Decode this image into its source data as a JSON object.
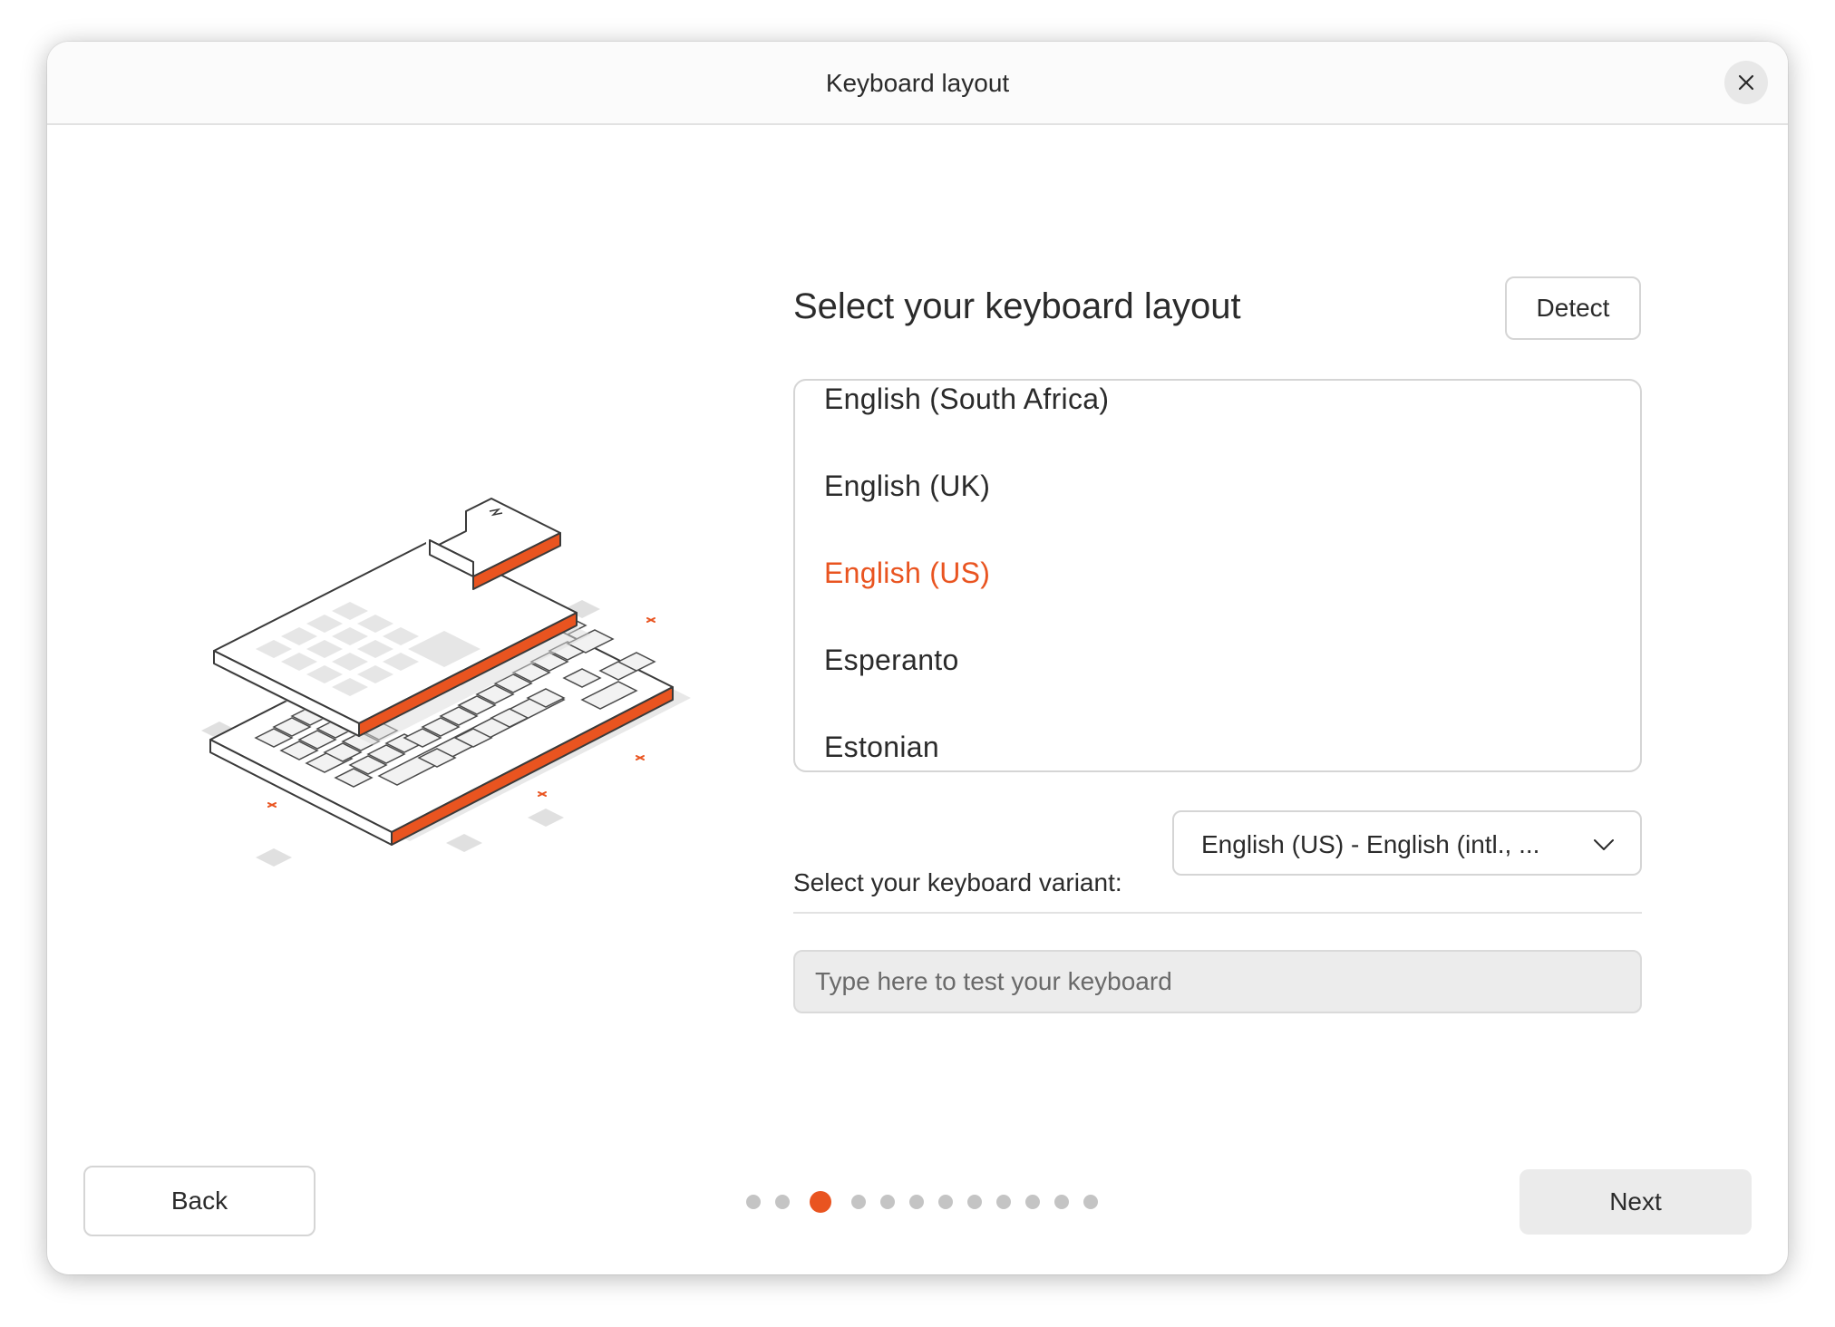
{
  "window": {
    "title": "Keyboard layout"
  },
  "main": {
    "heading": "Select your keyboard layout",
    "detect_label": "Detect",
    "layouts": [
      {
        "label": "English (South Africa)",
        "selected": false
      },
      {
        "label": "English (UK)",
        "selected": false
      },
      {
        "label": "English (US)",
        "selected": true
      },
      {
        "label": "Esperanto",
        "selected": false
      },
      {
        "label": "Estonian",
        "selected": false
      }
    ],
    "variant_label": "Select your keyboard variant:",
    "variant_value": "English (US) - English (intl., ...",
    "test_placeholder": "Type here to test your keyboard"
  },
  "footer": {
    "back_label": "Back",
    "next_label": "Next",
    "steps_total": 12,
    "current_step": 3
  },
  "colors": {
    "accent": "#e95420"
  },
  "icons": {
    "close": "close-icon",
    "dropdown": "chevron-down-icon",
    "illustration": "keyboard-illustration"
  }
}
